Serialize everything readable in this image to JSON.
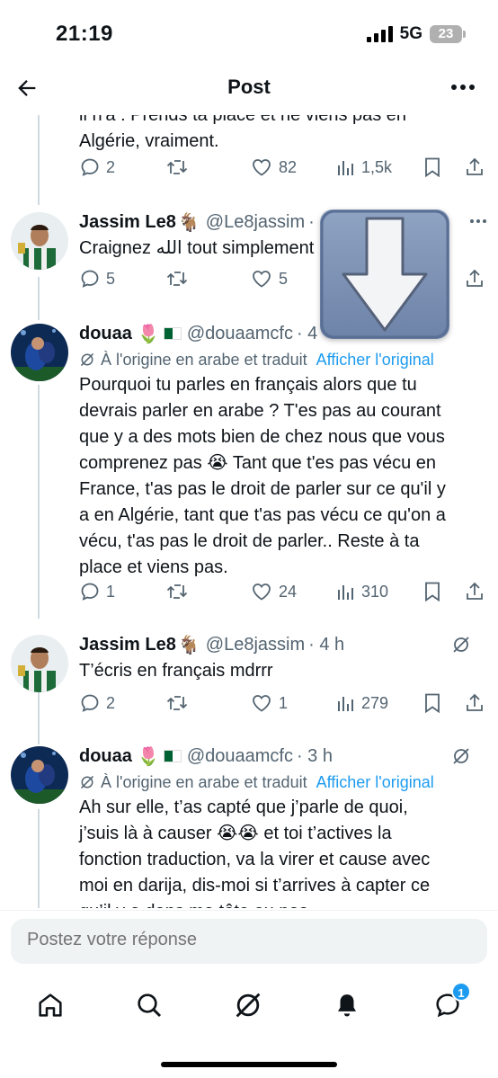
{
  "status_bar": {
    "time": "21:19",
    "network": "5G",
    "battery": "23"
  },
  "header": {
    "title": "Post"
  },
  "replies": [
    {
      "text_lines": [
        "il n'a : Prends ta place et ne viens pas en",
        "Algérie, vraiment."
      ],
      "stats": {
        "replies": "2",
        "likes": "82",
        "views": "1,5k"
      }
    },
    {
      "name": "Jassim Le8",
      "handle": "@Le8jassim",
      "meta": "·",
      "text": "Craignez الله tout simplement",
      "stats": {
        "replies": "5",
        "likes": "5"
      }
    },
    {
      "name": "douaa",
      "handle": "@douaamcfc",
      "meta": "· 4",
      "translated_label": "À l'origine en arabe et traduit",
      "show_original": "Afficher l'original",
      "text_lines": [
        "Pourquoi tu parles en français alors que tu",
        "devrais parler en arabe ? T'es pas au courant",
        "que y a des mots bien de chez nous que vous",
        "comprenez pas 😭 Tant que t'es pas vécu en",
        "France, t'as pas le droit de parler sur ce qu'il y",
        "a en Algérie, tant que t'as pas vécu ce qu'on a",
        "vécu, t'as pas le droit de parler.. Reste à ta",
        "place et viens pas."
      ],
      "stats": {
        "replies": "1",
        "likes": "24",
        "views": "310"
      }
    },
    {
      "name": "Jassim Le8",
      "handle": "@Le8jassim",
      "meta": "· 4 h",
      "text": "T’écris en français mdrrr",
      "stats": {
        "replies": "2",
        "likes": "1",
        "views": "279"
      }
    },
    {
      "name": "douaa",
      "handle": "@douaamcfc",
      "meta": "· 3 h",
      "translated_label": "À l'origine en arabe et traduit",
      "show_original": "Afficher l'original",
      "text_lines": [
        "Ah sur elle, t’as capté que j’parle de quoi,",
        "j’suis là à causer 😭😭 et toi t’actives la",
        "fonction traduction, va la virer et cause avec",
        "moi en darija, dis-moi si t’arrives à capter ce",
        "qu’il y a dans ma tête ou pas"
      ]
    }
  ],
  "reply_box": {
    "placeholder": "Postez votre réponse"
  },
  "bottom_nav": {
    "messages_badge": "1"
  },
  "colors": {
    "accent": "#1d9bf0",
    "muted": "#536471",
    "text": "#0f1419"
  },
  "icons": [
    "back-arrow-icon",
    "more-icon",
    "grok-icon",
    "reply-icon",
    "repost-icon",
    "like-icon",
    "views-icon",
    "bookmark-icon",
    "share-icon",
    "home-icon",
    "search-icon",
    "bell-icon",
    "messages-icon",
    "download-arrow-icon"
  ]
}
